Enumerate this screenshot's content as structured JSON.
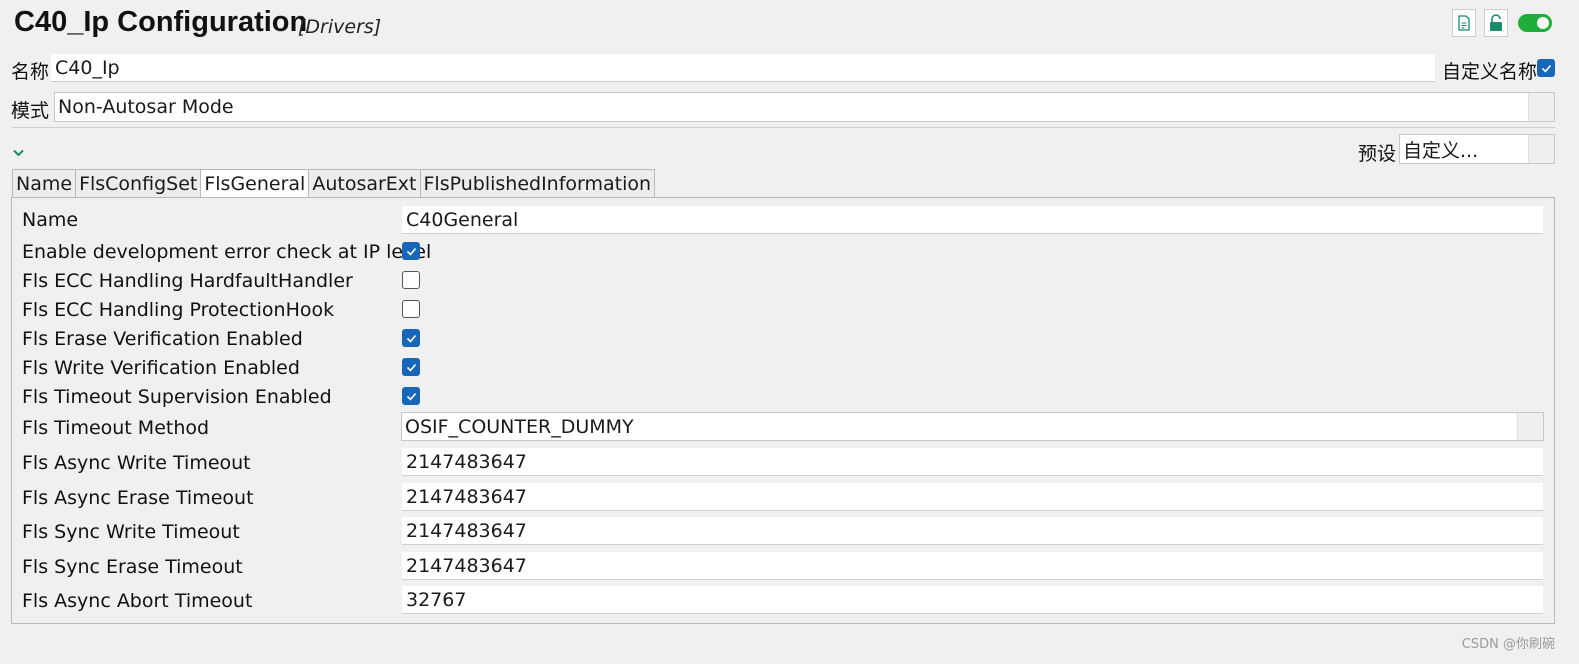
{
  "header": {
    "title": "C40_Ip Configuration",
    "subtitle": "[Drivers]",
    "icons": [
      "document-icon",
      "unlock-icon",
      "toggle-switch"
    ],
    "accent": "#1fae3a"
  },
  "name_row": {
    "label": "名称",
    "value": "C40_Ip",
    "custom_name_label": "自定义名称",
    "custom_name_checked": true
  },
  "mode_row": {
    "label": "模式",
    "value": "Non-Autosar Mode"
  },
  "preset": {
    "label": "预设",
    "value": "自定义..."
  },
  "tabs": [
    {
      "label": "Name",
      "active": false
    },
    {
      "label": "FlsConfigSet",
      "active": false
    },
    {
      "label": "FlsGeneral",
      "active": true
    },
    {
      "label": "AutosarExt",
      "active": false
    },
    {
      "label": "FlsPublishedInformation",
      "active": false
    }
  ],
  "general": {
    "name_label": "Name",
    "name_value": "C40General",
    "checks": [
      {
        "label": "Enable development error check at IP level",
        "checked": true
      },
      {
        "label": "Fls ECC Handling HardfaultHandler",
        "checked": false
      },
      {
        "label": "Fls ECC Handling ProtectionHook",
        "checked": false
      },
      {
        "label": "Fls Erase Verification Enabled",
        "checked": true
      },
      {
        "label": "Fls Write Verification Enabled",
        "checked": true
      },
      {
        "label": "Fls Timeout Supervision Enabled",
        "checked": true
      }
    ],
    "timeout_method_label": "Fls Timeout Method",
    "timeout_method_value": "OSIF_COUNTER_DUMMY",
    "timeouts": [
      {
        "label": "Fls Async Write Timeout",
        "value": "2147483647"
      },
      {
        "label": "Fls Async Erase Timeout",
        "value": "2147483647"
      },
      {
        "label": "Fls Sync Write Timeout",
        "value": "2147483647"
      },
      {
        "label": "Fls Sync Erase Timeout",
        "value": "2147483647"
      },
      {
        "label": "Fls Async Abort Timeout",
        "value": "32767"
      }
    ]
  },
  "watermark": "CSDN @你刷碗",
  "colors": {
    "checkbox": "#1866b8",
    "chevron": "#1a8a6a"
  }
}
